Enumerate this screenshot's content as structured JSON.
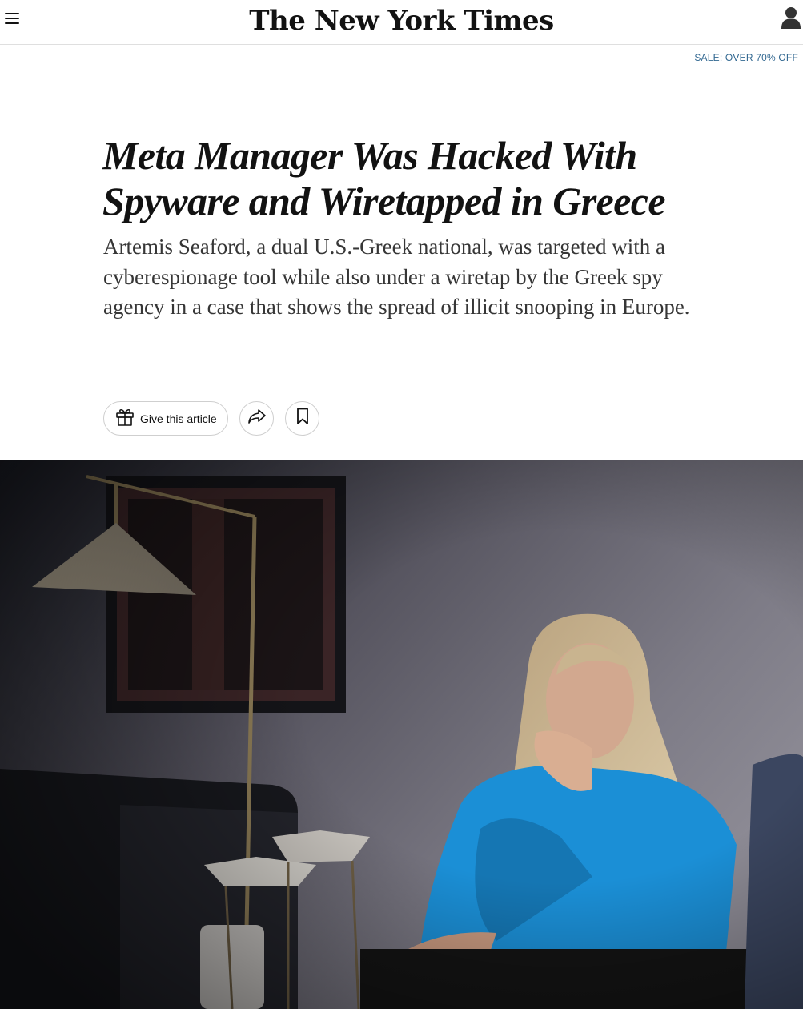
{
  "header": {
    "logo_text": "The New York Times",
    "menu_icon": "hamburger-menu-icon",
    "account_icon": "user-account-icon"
  },
  "promo": {
    "sale_label": "SALE: OVER 70% OFF",
    "color": "#326891"
  },
  "article": {
    "headline": "Meta Manager Was Hacked With Spyware and Wiretapped in Greece",
    "summary": "Artemis Seaford, a dual U.S.-Greek national, was targeted with a cyberespionage tool while also under a wiretap by the Greek spy agency in a case that shows the spread of illicit snooping in Europe."
  },
  "actions": {
    "gift_label": "Give this article",
    "gift_icon": "gift-icon",
    "share_icon": "share-arrow-icon",
    "save_icon": "bookmark-icon"
  },
  "lead_image": {
    "subject": "photo"
  }
}
